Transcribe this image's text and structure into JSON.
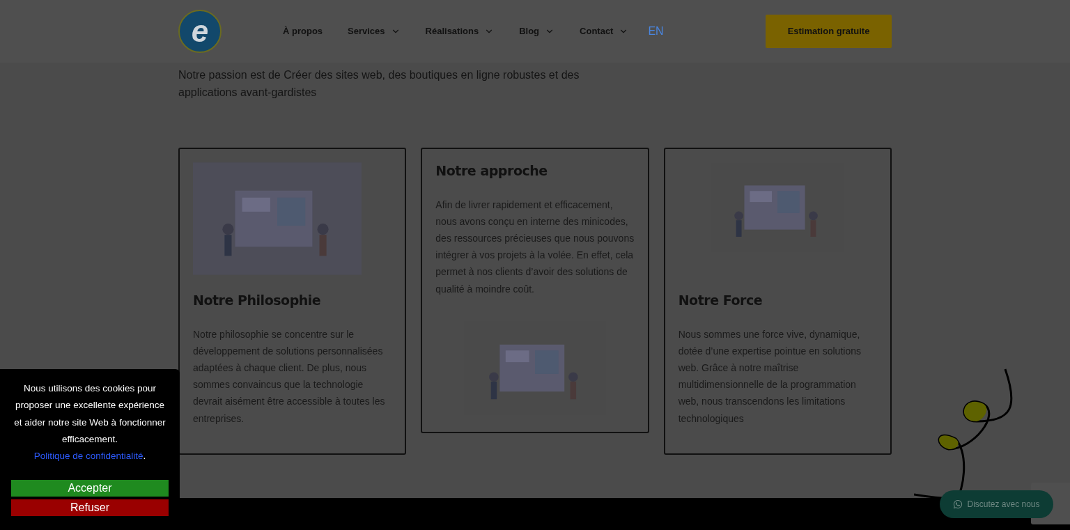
{
  "header": {
    "logo_letter": "e",
    "nav": [
      {
        "label": "À propos",
        "dropdown": false
      },
      {
        "label": "Services",
        "dropdown": true
      },
      {
        "label": "Réalisations",
        "dropdown": true
      },
      {
        "label": "Blog",
        "dropdown": true
      },
      {
        "label": "Contact",
        "dropdown": true
      }
    ],
    "language": "EN",
    "cta": "Estimation gratuite"
  },
  "intro": "Notre passion est de Créer des sites web, des boutiques en ligne robustes et des applications avant-gardistes",
  "cards": [
    {
      "kind": "image-top",
      "title": "Notre Philosophie",
      "text": "Notre philosophie se concentre sur le développement de solutions personnalisées adaptées à chaque client. De plus, nous sommes convaincus que la technologie devrait aisément être accessible à toutes les entreprises."
    },
    {
      "kind": "image-bottom",
      "title": "Notre approche",
      "text": "Afin de livrer rapidement et efficacement, nous avons conçu en interne des minicodes, des ressources précieuses que nous pouvons intégrer à vos projets à la volée. En effet, cela permet à nos clients d’avoir des solutions de qualité à moindre coût."
    },
    {
      "kind": "image-top",
      "title": "Notre Force",
      "text": "Nous sommes une force vive, dynamique, dotée d’une expertise pointue en solutions web. Grâce à notre maîtrise multidimensionnelle de la programmation web, nous transcendons les limitations technologiques"
    }
  ],
  "cookie_banner": {
    "message": "Nous utilisons des cookies pour proposer une excellente expérience et aider notre site Web à fonctionner efficacement.",
    "link": "Politique de confidentialité",
    "after_link": ".",
    "buttons": [
      {
        "label": "Accepter",
        "kind": "accept"
      },
      {
        "label": "Refuser",
        "kind": "refuse"
      }
    ]
  },
  "chat_button": "Discutez avec nous"
}
